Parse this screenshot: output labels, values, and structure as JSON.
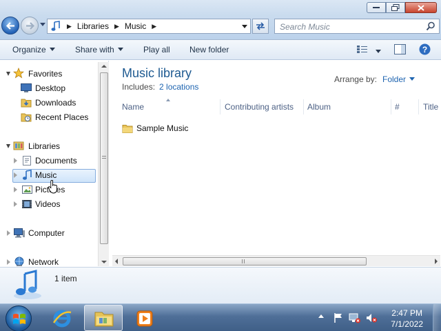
{
  "window": {
    "buttons": {
      "minimize": "minimize-icon",
      "maximize": "maximize-icon",
      "close": "close-icon"
    }
  },
  "address": {
    "breadcrumbs": [
      "Libraries",
      "Music"
    ],
    "search_placeholder": "Search Music"
  },
  "commands": {
    "organize": "Organize",
    "share_with": "Share with",
    "play_all": "Play all",
    "new_folder": "New folder"
  },
  "nav": {
    "favorites": "Favorites",
    "desktop": "Desktop",
    "downloads": "Downloads",
    "recent_places": "Recent Places",
    "libraries": "Libraries",
    "documents": "Documents",
    "music": "Music",
    "pictures": "Pictures",
    "videos": "Videos",
    "computer": "Computer",
    "network": "Network"
  },
  "content": {
    "title": "Music library",
    "includes_label": "Includes:",
    "includes_link": "2 locations",
    "arrange_label": "Arrange by:",
    "arrange_value": "Folder",
    "columns": [
      "Name",
      "Contributing artists",
      "Album",
      "#",
      "Title"
    ],
    "items": [
      {
        "name": "Sample Music"
      }
    ]
  },
  "details": {
    "count": "1 item"
  },
  "taskbar": {
    "time": "2:47 PM",
    "date": "7/1/2022",
    "colors": {
      "accent": "#1e5a91",
      "link": "#1e64b0"
    }
  }
}
